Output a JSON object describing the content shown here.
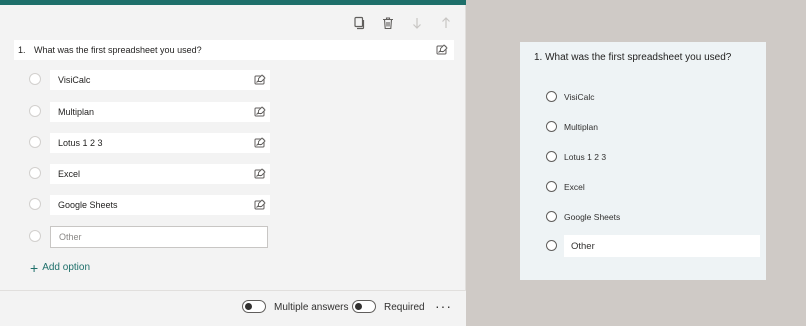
{
  "editor": {
    "toolbar": [
      "copy-icon",
      "delete-icon",
      "arrow-down-icon",
      "arrow-up-icon"
    ],
    "question": {
      "number": "1.",
      "text": "What was the first spreadsheet you used?"
    },
    "options": [
      "VisiCalc",
      "Multiplan",
      "Lotus 1 2 3",
      "Excel",
      "Google Sheets"
    ],
    "other_placeholder": "Other",
    "add_option_label": "Add option",
    "footer": {
      "multiple_answers_label": "Multiple answers",
      "required_label": "Required",
      "more_label": "···"
    },
    "accent_color": "#1e6f6a"
  },
  "preview": {
    "question": "1. What was the first spreadsheet you used?",
    "options": [
      "VisiCalc",
      "Multiplan",
      "Lotus 1 2 3",
      "Excel",
      "Google Sheets"
    ],
    "other_label": "Other"
  }
}
